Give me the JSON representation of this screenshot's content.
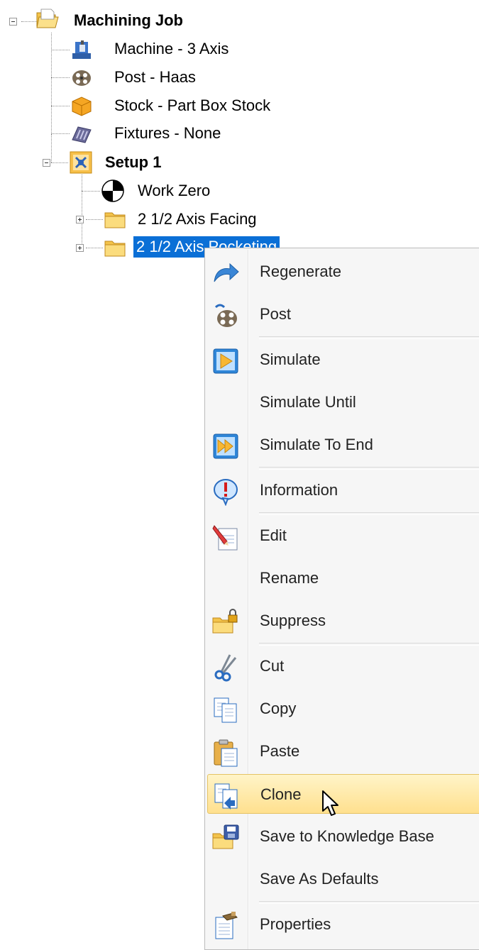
{
  "tree": {
    "root": {
      "label": "Machining Job"
    },
    "children": [
      {
        "label": "Machine - 3 Axis",
        "icon": "machine-icon"
      },
      {
        "label": "Post - Haas",
        "icon": "post-film-reel-icon"
      },
      {
        "label": "Stock - Part Box Stock",
        "icon": "stock-box-icon"
      },
      {
        "label": "Fixtures - None",
        "icon": "fixtures-icon"
      }
    ],
    "setup": {
      "label": "Setup 1",
      "children": [
        {
          "label": "Work Zero",
          "icon": "work-zero-icon"
        },
        {
          "label": "2 1/2 Axis Facing",
          "icon": "folder-icon"
        },
        {
          "label": "2 1/2 Axis Pocketing",
          "icon": "folder-icon",
          "selected": true
        }
      ]
    }
  },
  "context_menu": {
    "items": [
      {
        "label": "Regenerate",
        "icon": "regenerate-arrow-icon"
      },
      {
        "label": "Post",
        "icon": "post-film-reel-icon"
      },
      {
        "label": "Simulate",
        "icon": "simulate-play-icon"
      },
      {
        "label": "Simulate Until",
        "icon": ""
      },
      {
        "label": "Simulate To End",
        "icon": "simulate-to-end-icon"
      },
      {
        "label": "Information",
        "icon": "information-icon"
      },
      {
        "label": "Edit",
        "icon": "edit-pencil-icon"
      },
      {
        "label": "Rename",
        "icon": ""
      },
      {
        "label": "Suppress",
        "icon": "suppress-lock-folder-icon"
      },
      {
        "label": "Cut",
        "icon": "cut-scissors-icon"
      },
      {
        "label": "Copy",
        "icon": "copy-icon"
      },
      {
        "label": "Paste",
        "icon": "paste-clipboard-icon"
      },
      {
        "label": "Clone",
        "icon": "clone-icon",
        "hovered": true
      },
      {
        "label": "Save to Knowledge Base",
        "icon": "save-knowledge-base-icon"
      },
      {
        "label": "Save As Defaults",
        "icon": ""
      },
      {
        "label": "Properties",
        "icon": "properties-icon"
      }
    ]
  },
  "colors": {
    "selection": "#0a6fd6",
    "hover_top": "#fff4c8",
    "hover_bottom": "#ffe08e"
  }
}
